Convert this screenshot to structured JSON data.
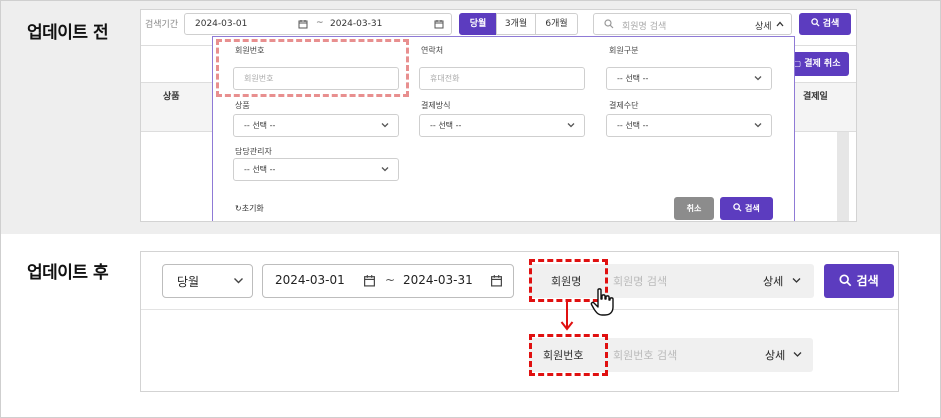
{
  "labels": {
    "before": "업데이트 전",
    "after": "업데이트 후"
  },
  "before": {
    "period_label": "검색기간",
    "date_from": "2024-03-01",
    "date_sep": "~",
    "date_to": "2024-03-31",
    "periods": [
      "당월",
      "3개월",
      "6개월"
    ],
    "active_period_index": 0,
    "search_placeholder": "회원명 검색",
    "detail_label": "상세",
    "search_button": "검색",
    "cancel_payment_button": "결제 취소",
    "table_headers": {
      "product": "상품",
      "payment_date": "결제일"
    },
    "popup": {
      "member_no": {
        "label": "회원번호",
        "placeholder": "회원번호"
      },
      "contact": {
        "label": "연락처",
        "placeholder": "휴대전화"
      },
      "member_type": {
        "label": "회원구분",
        "value": "-- 선택 --"
      },
      "product": {
        "label": "상품",
        "value": "-- 선택 --"
      },
      "payment_method": {
        "label": "결제방식",
        "value": "-- 선택 --"
      },
      "payment_means": {
        "label": "결제수단",
        "value": "-- 선택 --"
      },
      "manager": {
        "label": "담당관리자",
        "value": "-- 선택 --"
      },
      "reset_label": "초기화",
      "cancel_button": "취소",
      "search_button": "검색"
    }
  },
  "after": {
    "period_value": "당월",
    "date_from": "2024-03-01",
    "date_sep": "~",
    "date_to": "2024-03-31",
    "field_type_1": "회원명",
    "placeholder_1": "회원명 검색",
    "field_type_2": "회원번호",
    "placeholder_2": "회원번호 검색",
    "detail_label": "상세",
    "search_button": "검색"
  },
  "colors": {
    "accent": "#5c3cbf",
    "highlight_red": "#e01010",
    "highlight_pink": "#e88f8f"
  }
}
